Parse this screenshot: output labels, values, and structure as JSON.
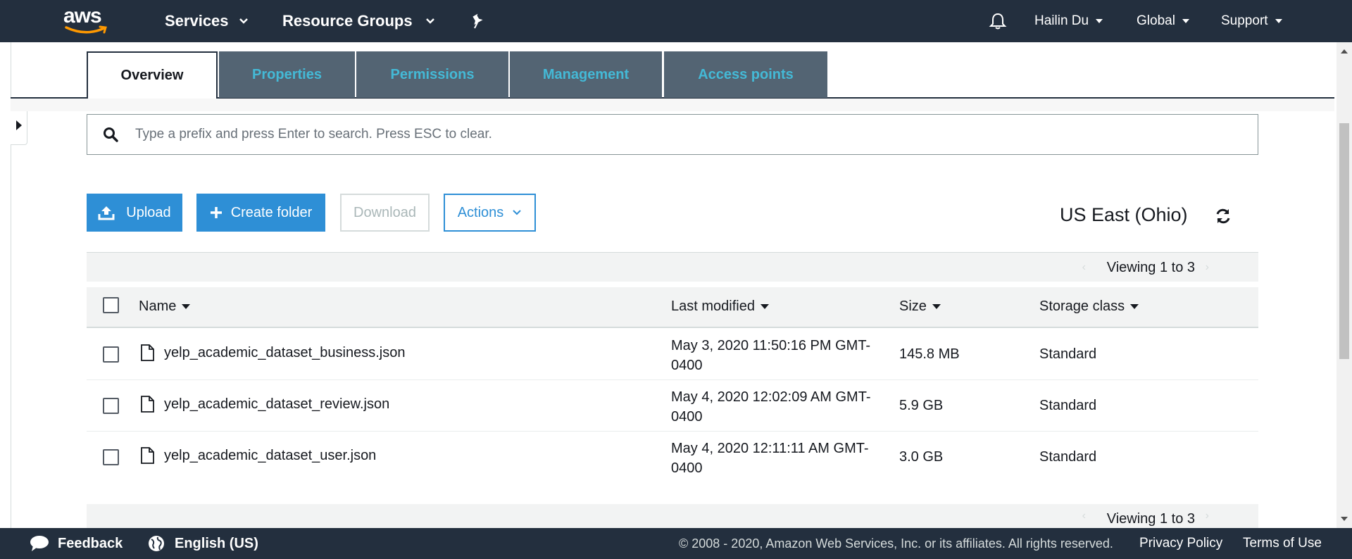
{
  "nav": {
    "logo_text": "aws",
    "services": "Services",
    "resource_groups": "Resource Groups",
    "user": "Hailin Du",
    "region_menu": "Global",
    "support": "Support"
  },
  "tabs": [
    {
      "label": "Overview",
      "active": true
    },
    {
      "label": "Properties",
      "active": false
    },
    {
      "label": "Permissions",
      "active": false
    },
    {
      "label": "Management",
      "active": false
    },
    {
      "label": "Access points",
      "active": false
    }
  ],
  "search": {
    "placeholder": "Type a prefix and press Enter to search. Press ESC to clear.",
    "value": ""
  },
  "toolbar": {
    "upload": "Upload",
    "create_folder": "Create folder",
    "download": "Download",
    "actions": "Actions",
    "region": "US East (Ohio)"
  },
  "pager": {
    "top": "Viewing 1 to 3",
    "bottom": "Viewing 1 to 3"
  },
  "table": {
    "columns": [
      "Name",
      "Last modified",
      "Size",
      "Storage class"
    ],
    "rows": [
      {
        "name": "yelp_academic_dataset_business.json",
        "modified_line1": "May 3, 2020 11:50:16 PM GMT-",
        "modified_line2": "0400",
        "size": "145.8 MB",
        "storage": "Standard"
      },
      {
        "name": "yelp_academic_dataset_review.json",
        "modified_line1": "May 4, 2020 12:02:09 AM GMT-",
        "modified_line2": "0400",
        "size": "5.9 GB",
        "storage": "Standard"
      },
      {
        "name": "yelp_academic_dataset_user.json",
        "modified_line1": "May 4, 2020 12:11:11 AM GMT-",
        "modified_line2": "0400",
        "size": "3.0 GB",
        "storage": "Standard"
      }
    ]
  },
  "footer": {
    "feedback": "Feedback",
    "language": "English (US)",
    "copyright": "© 2008 - 2020, Amazon Web Services, Inc. or its affiliates. All rights reserved.",
    "privacy": "Privacy Policy",
    "terms": "Terms of Use"
  },
  "colors": {
    "nav_bg": "#232f3e",
    "tab_inactive_bg": "#536473",
    "tab_inactive_text": "#44b9d6",
    "primary_button": "#2e8fd6"
  },
  "icons": [
    "bell-icon",
    "pin-icon",
    "search-icon",
    "upload-icon",
    "plus-icon",
    "chevron-down-icon",
    "refresh-icon",
    "file-icon",
    "feedback-bubble-icon",
    "globe-icon"
  ]
}
